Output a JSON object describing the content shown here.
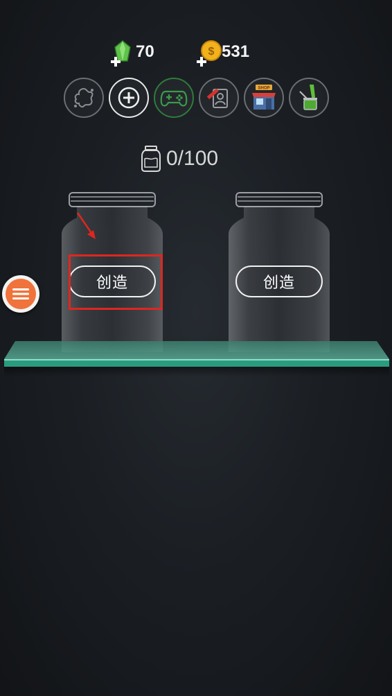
{
  "currency": {
    "gems": "70",
    "coins": "531"
  },
  "toolbar": {
    "items": [
      {
        "name": "splat"
      },
      {
        "name": "add",
        "active": true
      },
      {
        "name": "game"
      },
      {
        "name": "edit"
      },
      {
        "name": "shop",
        "badge": "SHOP"
      },
      {
        "name": "pour"
      }
    ]
  },
  "collection": {
    "counter": "0/100"
  },
  "jars": [
    {
      "button_label": "创造"
    },
    {
      "button_label": "创造"
    }
  ],
  "colors": {
    "accent_red": "#e0261e",
    "menu_orange": "#f0733b",
    "shelf_teal": "#3aa58a"
  }
}
